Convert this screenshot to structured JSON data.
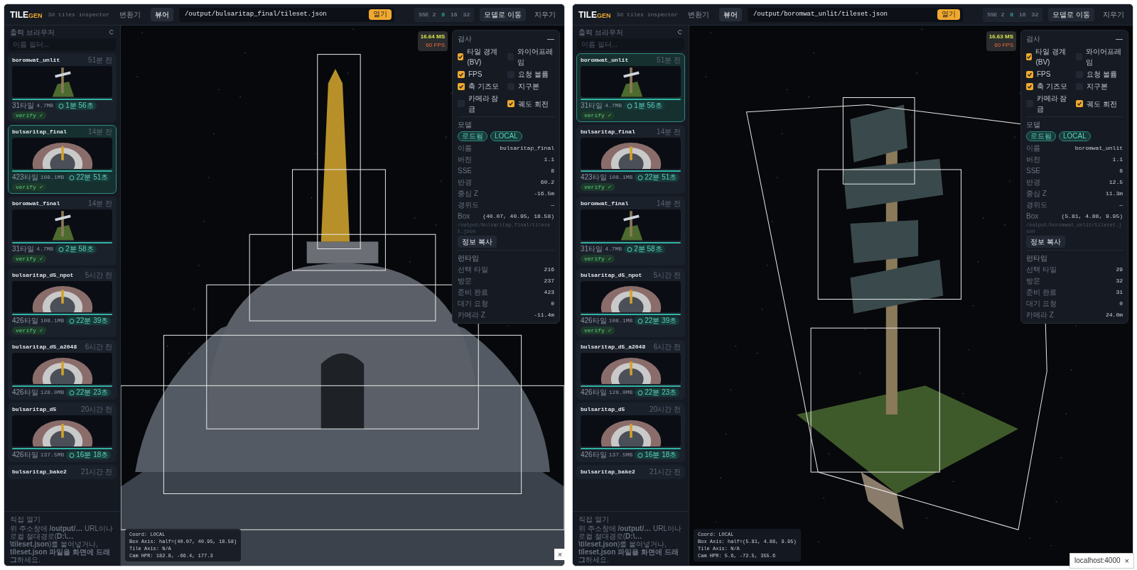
{
  "windows": [
    {
      "brand": {
        "prefix": "TILE",
        "suffix": "GEN"
      },
      "subtitle": "3d tiles inspector",
      "nav": [
        {
          "label": "변환기",
          "selected": false
        },
        {
          "label": "뷰어",
          "selected": true
        }
      ],
      "path": "/output/bulsaritap_final/tileset.json",
      "open_button": "열기",
      "sse": {
        "label": "SSE 2",
        "options": [
          {
            "label": "8",
            "selected": true
          },
          {
            "label": "16",
            "selected": false
          },
          {
            "label": "32",
            "selected": false
          }
        ]
      },
      "goto_button": "모델로 이동",
      "clear_button": "지우기",
      "sidebar": {
        "title": "출력 브라우저",
        "filter_placeholder": "이름 필터...",
        "items": [
          {
            "kind": "post",
            "name": "boromwat_unlit",
            "age": "51분 전",
            "tiles": "31타일",
            "size": "4.7MB",
            "duration": "1분 56초",
            "verify": "verify ✓",
            "selected": false
          },
          {
            "kind": "ring",
            "name": "bulsaritap_final",
            "age": "14분 전",
            "tiles": "423타일",
            "size": "108.1MB",
            "duration": "22분 51초",
            "verify": "verify ✓",
            "selected": true
          },
          {
            "kind": "post",
            "name": "boromwat_final",
            "age": "14분 전",
            "tiles": "31타일",
            "size": "4.7MB",
            "duration": "2분 58초",
            "verify": "verify ✓",
            "selected": false
          },
          {
            "kind": "ring",
            "name": "bulsaritap_d5_npot",
            "age": "5시간 전",
            "tiles": "426타일",
            "size": "108.1MB",
            "duration": "22분 39초",
            "verify": "verify ✓",
            "selected": false
          },
          {
            "kind": "ring",
            "name": "bulsaritap_d5_a2048",
            "age": "6시간 전",
            "tiles": "426타일",
            "size": "128.0MB",
            "duration": "22분 23초",
            "selected": false
          },
          {
            "kind": "ring",
            "name": "bulsaritap_d5",
            "age": "20시간 전",
            "tiles": "426타일",
            "size": "137.5MB",
            "duration": "16분 18초",
            "selected": false
          },
          {
            "kind": "partial",
            "name": "bulsaritap_bake2",
            "age": "21시간 전",
            "selected": false
          }
        ],
        "footer": {
          "title": "직접 열기",
          "text": "위 주소창에 **/output/…** URL이나 로컬 절대경로(**D:\\…\\tileset.json**)를 붙여넣거나, **tileset.json 파일을 화면에 드래그**하세요."
        }
      },
      "scene": {
        "kind": "stupa"
      },
      "stats": {
        "ms": "16.64 MS",
        "fps": "60 FPS"
      },
      "inspector": {
        "title": "검사",
        "collapse": "—",
        "checks": [
          {
            "label": "타일 경계(BV)",
            "checked": true
          },
          {
            "label": "와이어프레임",
            "checked": false
          },
          {
            "label": "FPS",
            "checked": true
          },
          {
            "label": "요청 볼륨",
            "checked": false
          },
          {
            "label": "축 기즈모",
            "checked": true
          },
          {
            "label": "지구본",
            "checked": false
          },
          {
            "label": "카메라 잠금",
            "checked": false
          },
          {
            "label": "궤도 회전",
            "checked": true
          }
        ],
        "model": {
          "title": "모델",
          "badges": [
            "로드됨",
            "LOCAL"
          ],
          "rows": [
            {
              "label": "이름",
              "value": "bulsaritap_final"
            },
            {
              "label": "버전",
              "value": "1.1"
            },
            {
              "label": "SSE",
              "value": "8"
            },
            {
              "label": "반경",
              "value": "60.2"
            },
            {
              "label": "중심 Z",
              "value": "-16.5m"
            },
            {
              "label": "경위도",
              "value": "—"
            },
            {
              "label": "Box",
              "value": "(40.07, 40.95, 18.58)"
            }
          ],
          "path": "/output/bulsaritap_final/tileset.json",
          "copy_button": "정보 복사"
        },
        "runtime": {
          "title": "런타임",
          "rows": [
            {
              "label": "선택 타일",
              "value": "216"
            },
            {
              "label": "방문",
              "value": "237"
            },
            {
              "label": "준비 완료",
              "value": "423"
            },
            {
              "label": "대기 요청",
              "value": "0"
            },
            {
              "label": "카메라 Z",
              "value": "-11.4m"
            }
          ]
        }
      },
      "info_lines": [
        "Coord: LOCAL",
        "Box Axis: half=(40.07, 40.95, 18.58)",
        "Tile Axis: N/A",
        "Cam HPR: 182.8, -66.4, 177.3"
      ]
    },
    {
      "brand": {
        "prefix": "TILE",
        "suffix": "GEN"
      },
      "subtitle": "3d tiles inspector",
      "nav": [
        {
          "label": "변환기",
          "selected": false
        },
        {
          "label": "뷰어",
          "selected": true
        }
      ],
      "path": "/output/boromwat_unlit/tileset.json",
      "open_button": "열기",
      "sse": {
        "label": "SSE 2",
        "options": [
          {
            "label": "8",
            "selected": true
          },
          {
            "label": "16",
            "selected": false
          },
          {
            "label": "32",
            "selected": false
          }
        ]
      },
      "goto_button": "모델로 이동",
      "clear_button": "지우기",
      "sidebar": {
        "title": "출력 브라우저",
        "filter_placeholder": "이름 필터...",
        "items": [
          {
            "kind": "post",
            "name": "boromwat_unlit",
            "age": "51분 전",
            "tiles": "31타일",
            "size": "4.7MB",
            "duration": "1분 56초",
            "verify": "verify ✓",
            "selected": true
          },
          {
            "kind": "ring",
            "name": "bulsaritap_final",
            "age": "14분 전",
            "tiles": "423타일",
            "size": "108.1MB",
            "duration": "22분 51초",
            "verify": "verify ✓",
            "selected": false
          },
          {
            "kind": "post",
            "name": "boromwat_final",
            "age": "14분 전",
            "tiles": "31타일",
            "size": "4.7MB",
            "duration": "2분 58초",
            "verify": "verify ✓",
            "selected": false
          },
          {
            "kind": "ring",
            "name": "bulsaritap_d5_npot",
            "age": "5시간 전",
            "tiles": "426타일",
            "size": "108.1MB",
            "duration": "22분 39초",
            "verify": "verify ✓",
            "selected": false
          },
          {
            "kind": "ring",
            "name": "bulsaritap_d5_a2048",
            "age": "6시간 전",
            "tiles": "426타일",
            "size": "128.0MB",
            "duration": "22분 23초",
            "selected": false
          },
          {
            "kind": "ring",
            "name": "bulsaritap_d5",
            "age": "20시간 전",
            "tiles": "426타일",
            "size": "137.5MB",
            "duration": "16분 18초",
            "selected": false
          },
          {
            "kind": "partial",
            "name": "bulsaritap_bake2",
            "age": "21시간 전",
            "selected": false
          }
        ],
        "footer": {
          "title": "직접 열기",
          "text": "위 주소창에 **/output/…** URL이나 로컬 절대경로(**D:\\…\\tileset.json**)를 붙여넣거나, **tileset.json 파일을 화면에 드래그**하세요."
        }
      },
      "scene": {
        "kind": "signpost"
      },
      "stats": {
        "ms": "16.63 MS",
        "fps": "60 FPS"
      },
      "inspector": {
        "title": "검사",
        "collapse": "—",
        "checks": [
          {
            "label": "타일 경계(BV)",
            "checked": true
          },
          {
            "label": "와이어프레임",
            "checked": false
          },
          {
            "label": "FPS",
            "checked": true
          },
          {
            "label": "요청 볼륨",
            "checked": false
          },
          {
            "label": "축 기즈모",
            "checked": true
          },
          {
            "label": "지구본",
            "checked": false
          },
          {
            "label": "카메라 잠금",
            "checked": false
          },
          {
            "label": "궤도 회전",
            "checked": true
          }
        ],
        "model": {
          "title": "모델",
          "badges": [
            "로드됨",
            "LOCAL"
          ],
          "rows": [
            {
              "label": "이름",
              "value": "boromwat_unlit"
            },
            {
              "label": "버전",
              "value": "1.1"
            },
            {
              "label": "SSE",
              "value": "8"
            },
            {
              "label": "반경",
              "value": "12.5"
            },
            {
              "label": "중심 Z",
              "value": "11.3m"
            },
            {
              "label": "경위도",
              "value": "—"
            },
            {
              "label": "Box",
              "value": "(5.81, 4.88, 9.95)"
            }
          ],
          "path": "/output/boromwat_unlit/tileset.json",
          "copy_button": "정보 복사"
        },
        "runtime": {
          "title": "런타임",
          "rows": [
            {
              "label": "선택 타일",
              "value": "29"
            },
            {
              "label": "방문",
              "value": "32"
            },
            {
              "label": "준비 완료",
              "value": "31"
            },
            {
              "label": "대기 요청",
              "value": "0"
            },
            {
              "label": "카메라 Z",
              "value": "24.0m"
            }
          ]
        }
      },
      "info_lines": [
        "Coord: LOCAL",
        "Box Axis: half=(5.81, 4.88, 9.95)",
        "Tile Axis: N/A",
        "Cam HPR: 5.6, -72.5, 355.6"
      ]
    }
  ],
  "close_mark": "×",
  "tooltip": {
    "text": "localhost:4000",
    "close": "×"
  }
}
